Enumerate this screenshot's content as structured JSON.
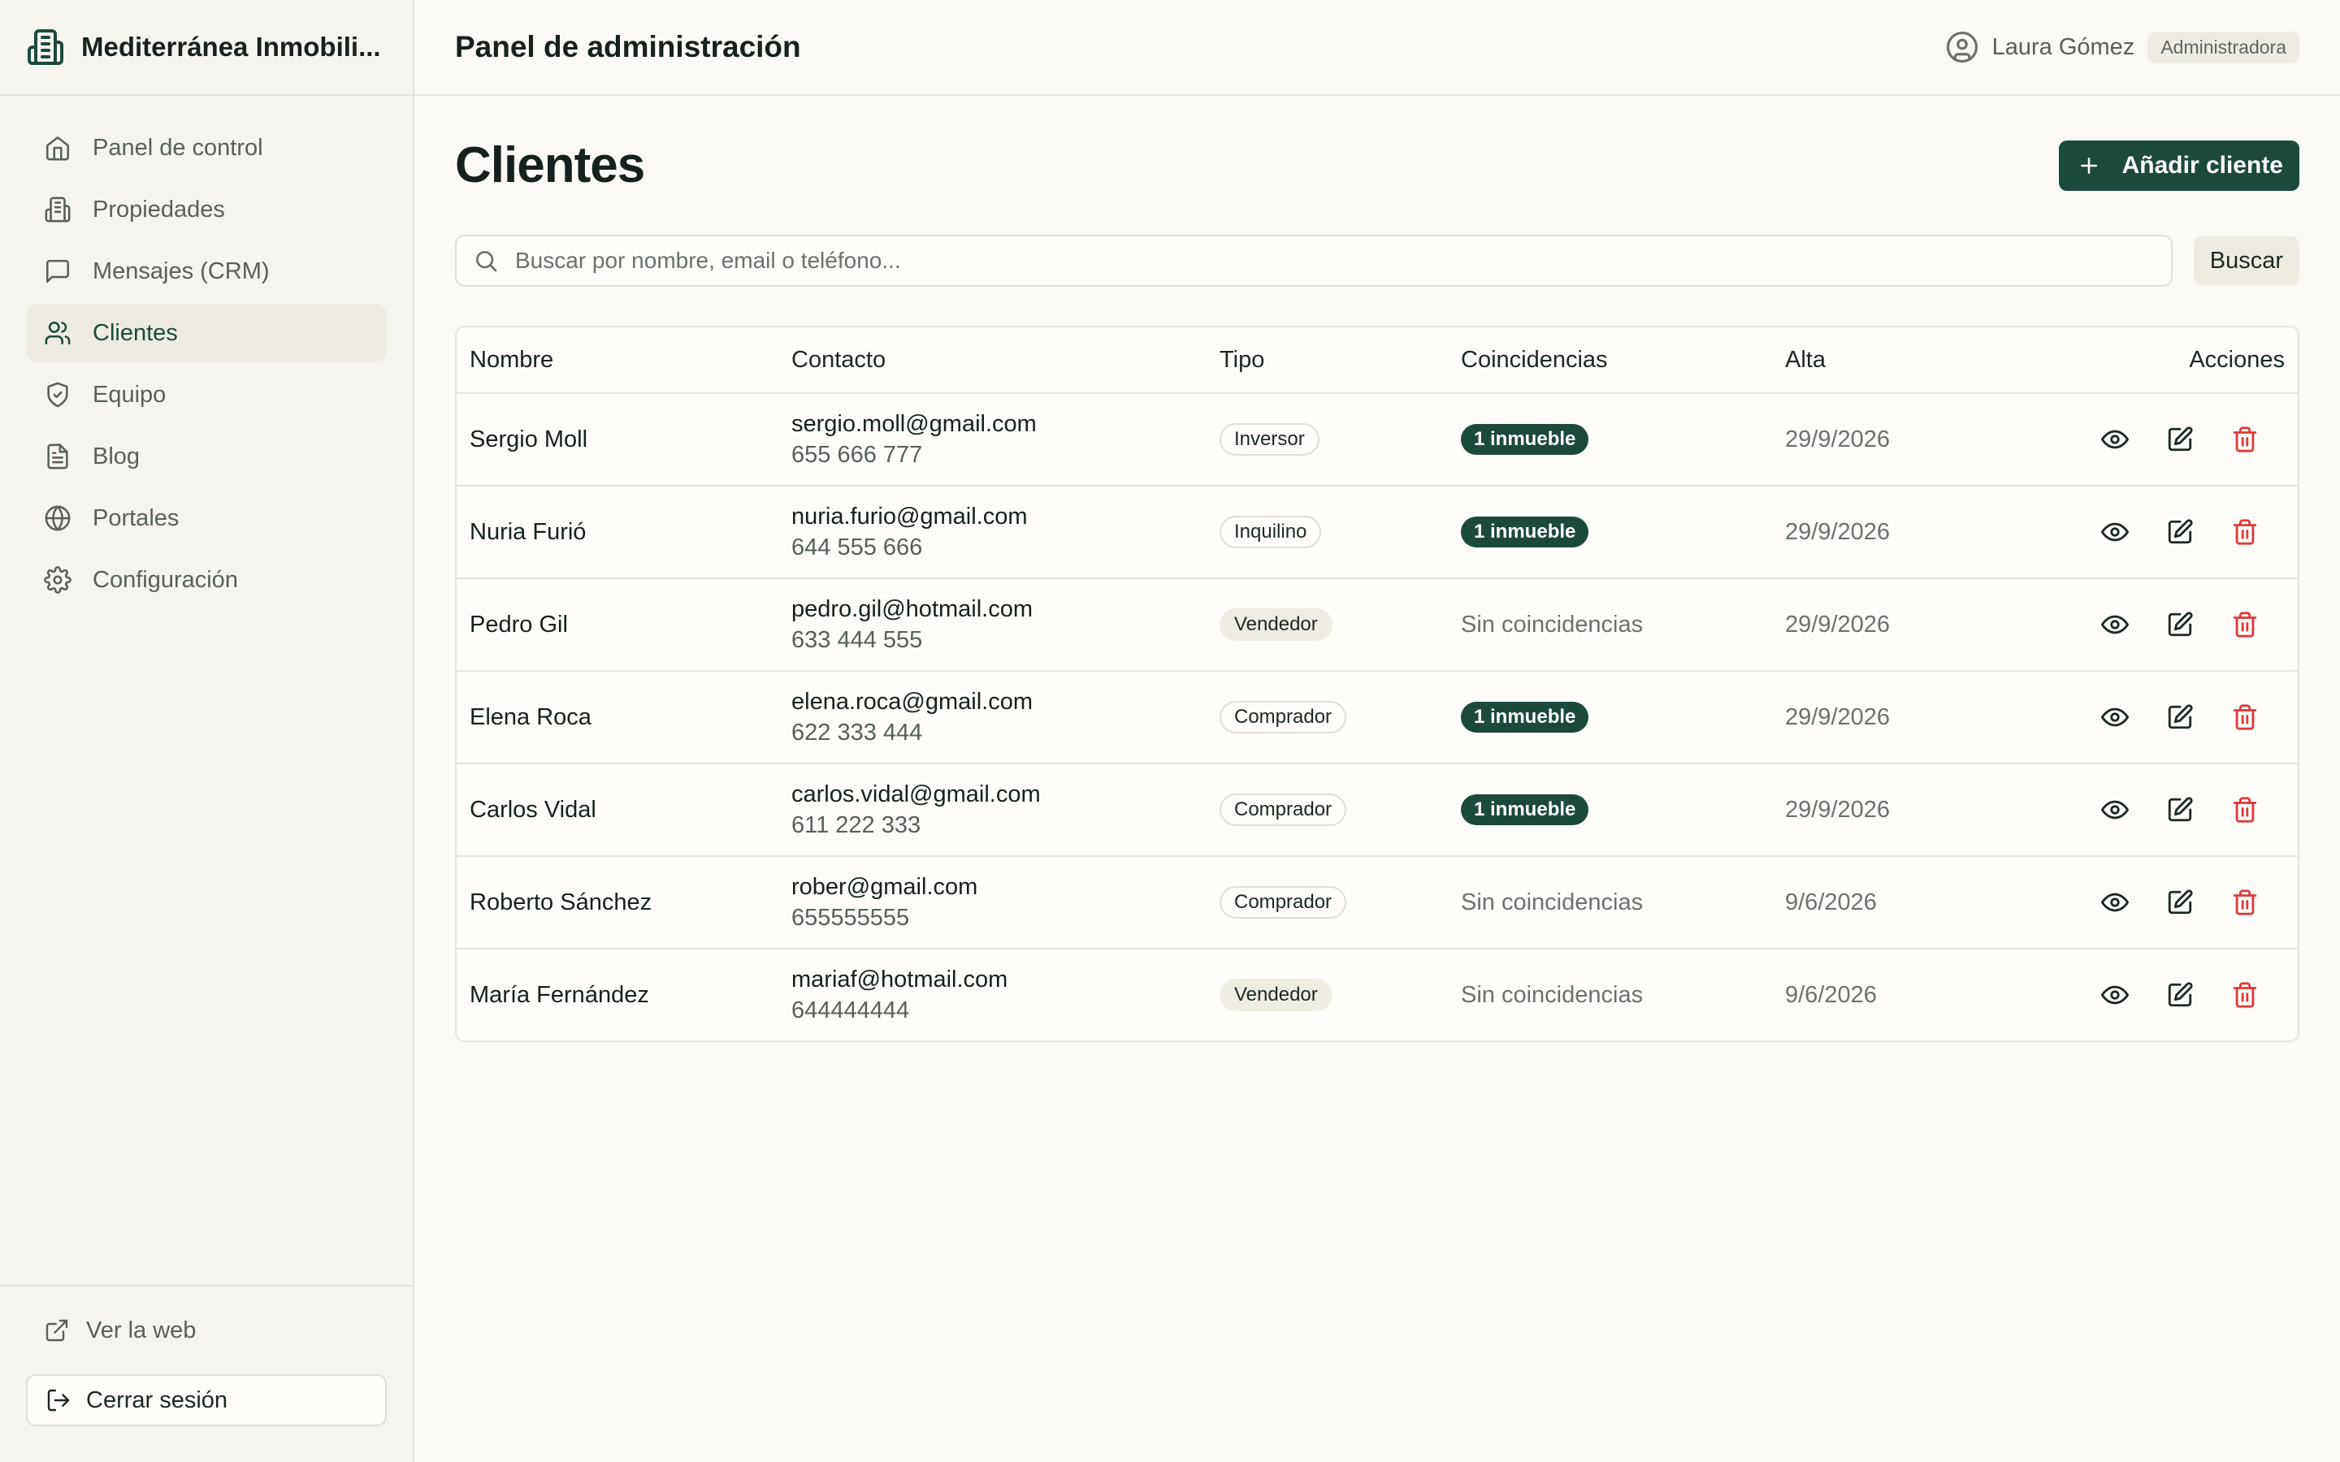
{
  "brand": {
    "name": "Mediterránea Inmobili..."
  },
  "sidebar": {
    "items": [
      {
        "label": "Panel de control",
        "icon": "home-icon"
      },
      {
        "label": "Propiedades",
        "icon": "building-icon"
      },
      {
        "label": "Mensajes (CRM)",
        "icon": "message-icon"
      },
      {
        "label": "Clientes",
        "icon": "users-icon",
        "active": true
      },
      {
        "label": "Equipo",
        "icon": "shield-icon"
      },
      {
        "label": "Blog",
        "icon": "document-icon"
      },
      {
        "label": "Portales",
        "icon": "globe-icon"
      },
      {
        "label": "Configuración",
        "icon": "gear-icon"
      }
    ],
    "footer": {
      "view_site": "Ver la web",
      "logout": "Cerrar sesión"
    }
  },
  "header": {
    "title": "Panel de administración",
    "user_name": "Laura Gómez",
    "role": "Administradora"
  },
  "main": {
    "title": "Clientes",
    "add_button": "Añadir cliente",
    "search": {
      "placeholder": "Buscar por nombre, email o teléfono...",
      "button": "Buscar"
    },
    "table": {
      "columns": [
        "Nombre",
        "Contacto",
        "Tipo",
        "Coincidencias",
        "Alta",
        "Acciones"
      ],
      "rows": [
        {
          "name": "Sergio Moll",
          "email": "sergio.moll@gmail.com",
          "phone": "655 666 777",
          "type": "Inversor",
          "matches": "1 inmueble",
          "date": "29/9/2026"
        },
        {
          "name": "Nuria Furió",
          "email": "nuria.furio@gmail.com",
          "phone": "644 555 666",
          "type": "Inquilino",
          "matches": "1 inmueble",
          "date": "29/9/2026"
        },
        {
          "name": "Pedro Gil",
          "email": "pedro.gil@hotmail.com",
          "phone": "633 444 555",
          "type": "Vendedor",
          "matches": "Sin coincidencias",
          "date": "29/9/2026"
        },
        {
          "name": "Elena Roca",
          "email": "elena.roca@gmail.com",
          "phone": "622 333 444",
          "type": "Comprador",
          "matches": "1 inmueble",
          "date": "29/9/2026"
        },
        {
          "name": "Carlos Vidal",
          "email": "carlos.vidal@gmail.com",
          "phone": "611 222 333",
          "type": "Comprador",
          "matches": "1 inmueble",
          "date": "29/9/2026"
        },
        {
          "name": "Roberto Sánchez",
          "email": "rober@gmail.com",
          "phone": "655555555",
          "type": "Comprador",
          "matches": "Sin coincidencias",
          "date": "9/6/2026"
        },
        {
          "name": "María Fernández",
          "email": "mariaf@hotmail.com",
          "phone": "644444444",
          "type": "Vendedor",
          "matches": "Sin coincidencias",
          "date": "9/6/2026"
        }
      ]
    }
  },
  "colors": {
    "accent": "#1b4a3d",
    "background": "#faf9f5",
    "danger": "#dc3b3b"
  }
}
